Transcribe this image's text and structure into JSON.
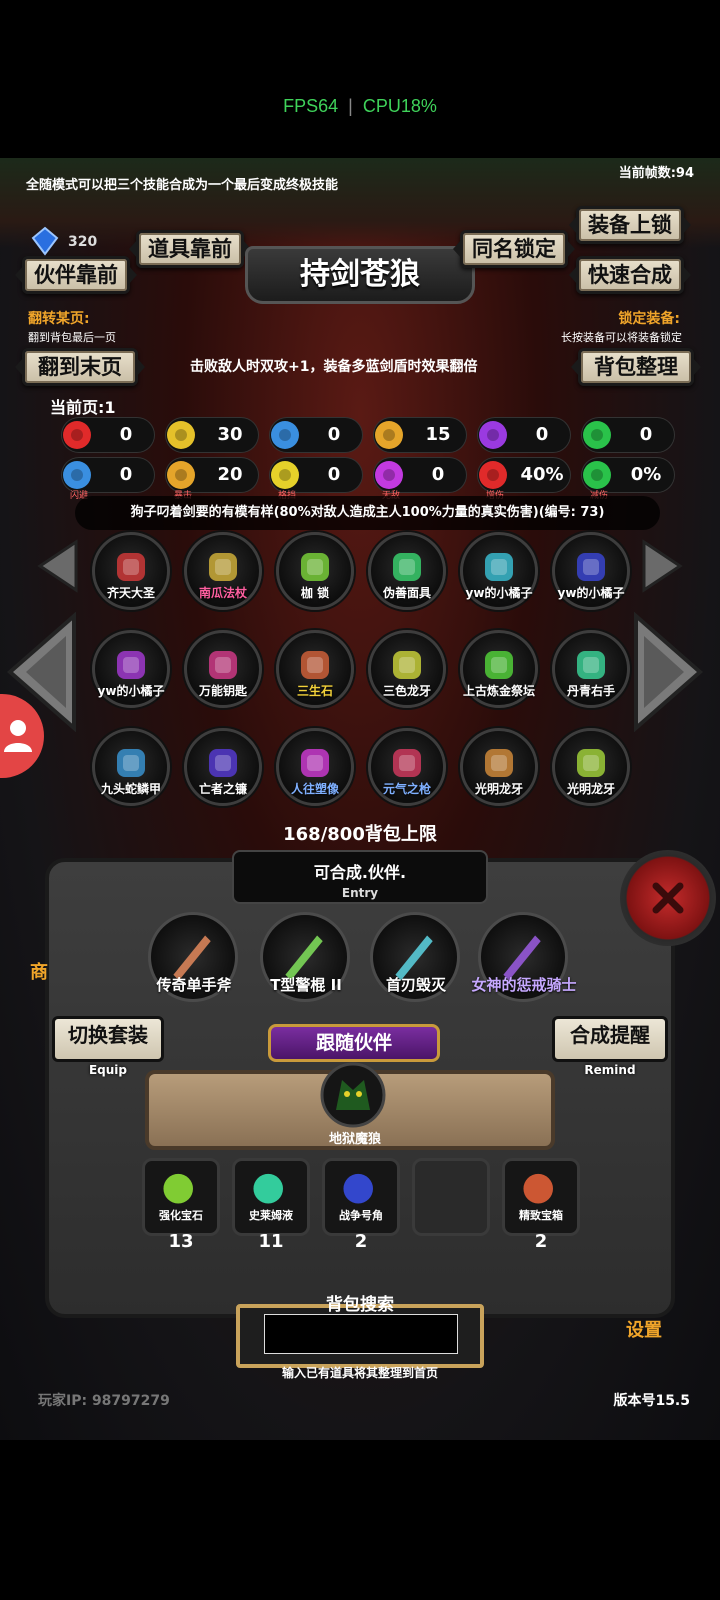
{
  "status_bar": {
    "fps": "FPS64",
    "cpu": "CPU18%"
  },
  "header": {
    "tip": "全随模式可以把三个技能合成为一个最后变成终极技能",
    "frame_count": "当前帧数:94",
    "gem_count": "320",
    "title": "持剑苍狼"
  },
  "buttons": {
    "partner_front": "伙伴靠前",
    "item_front": "道具靠前",
    "same_name_lock": "同名锁定",
    "equip_lock": "装备上锁",
    "quick_merge": "快速合成",
    "to_last_page": "翻到末页",
    "bag_sort": "背包整理",
    "switch_set": "切换套装",
    "switch_set_en": "Equip",
    "merge_remind": "合成提醒",
    "merge_remind_en": "Remind"
  },
  "flip": {
    "title": "翻转某页:",
    "desc": "翻到背包最后一页"
  },
  "lock_equip": {
    "title": "锁定装备:",
    "desc": "长按装备可以将装备锁定"
  },
  "effect_text": "击败敌人时双攻+1，装备多蓝剑盾时效果翻倍",
  "current_page": "当前页:1",
  "stats": [
    {
      "icon": "heart-icon",
      "value": "0",
      "label": "",
      "color": "#e02a2a"
    },
    {
      "icon": "strength-icon",
      "value": "30",
      "label": "",
      "color": "#e5c12a"
    },
    {
      "icon": "helmet-icon",
      "value": "0",
      "label": "",
      "color": "#3a8fe0"
    },
    {
      "icon": "sword-icon",
      "value": "15",
      "label": "",
      "color": "#e5a52a"
    },
    {
      "icon": "lightning-icon",
      "value": "0",
      "label": "",
      "color": "#9a3ae0"
    },
    {
      "icon": "clover-icon",
      "value": "0",
      "label": "",
      "color": "#2ac24a"
    },
    {
      "icon": "dodge-icon",
      "value": "0",
      "label": "闪避",
      "color": "#3a8fe0"
    },
    {
      "icon": "crit-icon",
      "value": "20",
      "label": "暴击",
      "color": "#e5a52a"
    },
    {
      "icon": "block-icon",
      "value": "0",
      "label": "格挡",
      "color": "#e5d12a"
    },
    {
      "icon": "invincible-icon",
      "value": "0",
      "label": "无敌",
      "color": "#c23ae0"
    },
    {
      "icon": "damage-up-icon",
      "value": "40%",
      "label": "增伤",
      "color": "#e02a2a"
    },
    {
      "icon": "damage-reduce-icon",
      "value": "0%",
      "label": "减伤",
      "color": "#2ac24a"
    }
  ],
  "item_desc": "狗子叼着剑要的有模有样(80%对敌人造成主人100%力量的真实伤害)(编号: 73)",
  "bag_items": [
    {
      "name": "齐天大圣",
      "color": "#ffffff"
    },
    {
      "name": "南瓜法杖",
      "color": "#ff5fa0"
    },
    {
      "name": "枷 锁",
      "color": "#ffffff"
    },
    {
      "name": "伪善面具",
      "color": "#ffffff"
    },
    {
      "name": "yw的小橘子",
      "color": "#ffffff"
    },
    {
      "name": "yw的小橘子",
      "color": "#ffffff"
    },
    {
      "name": "yw的小橘子",
      "color": "#ffffff"
    },
    {
      "name": "万能钥匙",
      "color": "#ffffff"
    },
    {
      "name": "三生石",
      "color": "#f3d23a"
    },
    {
      "name": "三色龙牙",
      "color": "#ffffff"
    },
    {
      "name": "上古炼金祭坛",
      "color": "#ffffff"
    },
    {
      "name": "丹青右手",
      "color": "#ffffff"
    },
    {
      "name": "九头蛇鳞甲",
      "color": "#ffffff"
    },
    {
      "name": "亡者之镰",
      "color": "#ffffff"
    },
    {
      "name": "人往塑像",
      "color": "#7fb0ff"
    },
    {
      "name": "元气之枪",
      "color": "#7fb0ff"
    },
    {
      "name": "光明龙牙",
      "color": "#ffffff"
    },
    {
      "name": "光明龙牙",
      "color": "#ffffff"
    }
  ],
  "bag_capacity": "168/800背包上限",
  "entry": {
    "title": "可合成.伙伴.",
    "sub": "Entry"
  },
  "merge_items": [
    {
      "name": "传奇单手斧",
      "color": "#ffffff"
    },
    {
      "name": "T型警棍 II",
      "color": "#ffffff"
    },
    {
      "name": "首刃毁灭",
      "color": "#ffffff"
    },
    {
      "name": "女神的惩戒骑士",
      "color": "#c6a8ff"
    }
  ],
  "follow": {
    "title": "跟随伙伴",
    "partner": "地狱魔狼"
  },
  "resources": [
    {
      "name": "强化宝石",
      "count": "13"
    },
    {
      "name": "史莱姆液",
      "count": "11"
    },
    {
      "name": "战争号角",
      "count": "2"
    },
    {
      "name": "",
      "count": ""
    },
    {
      "name": "精致宝箱",
      "count": "2"
    }
  ],
  "search": {
    "title": "背包搜索",
    "value": "",
    "hint": "输入已有道具将其整理到首页"
  },
  "footer": {
    "player_ip": "玩家IP:  98797279",
    "version": "版本号15.5"
  },
  "side": {
    "shop": "商",
    "settings": "设置"
  }
}
